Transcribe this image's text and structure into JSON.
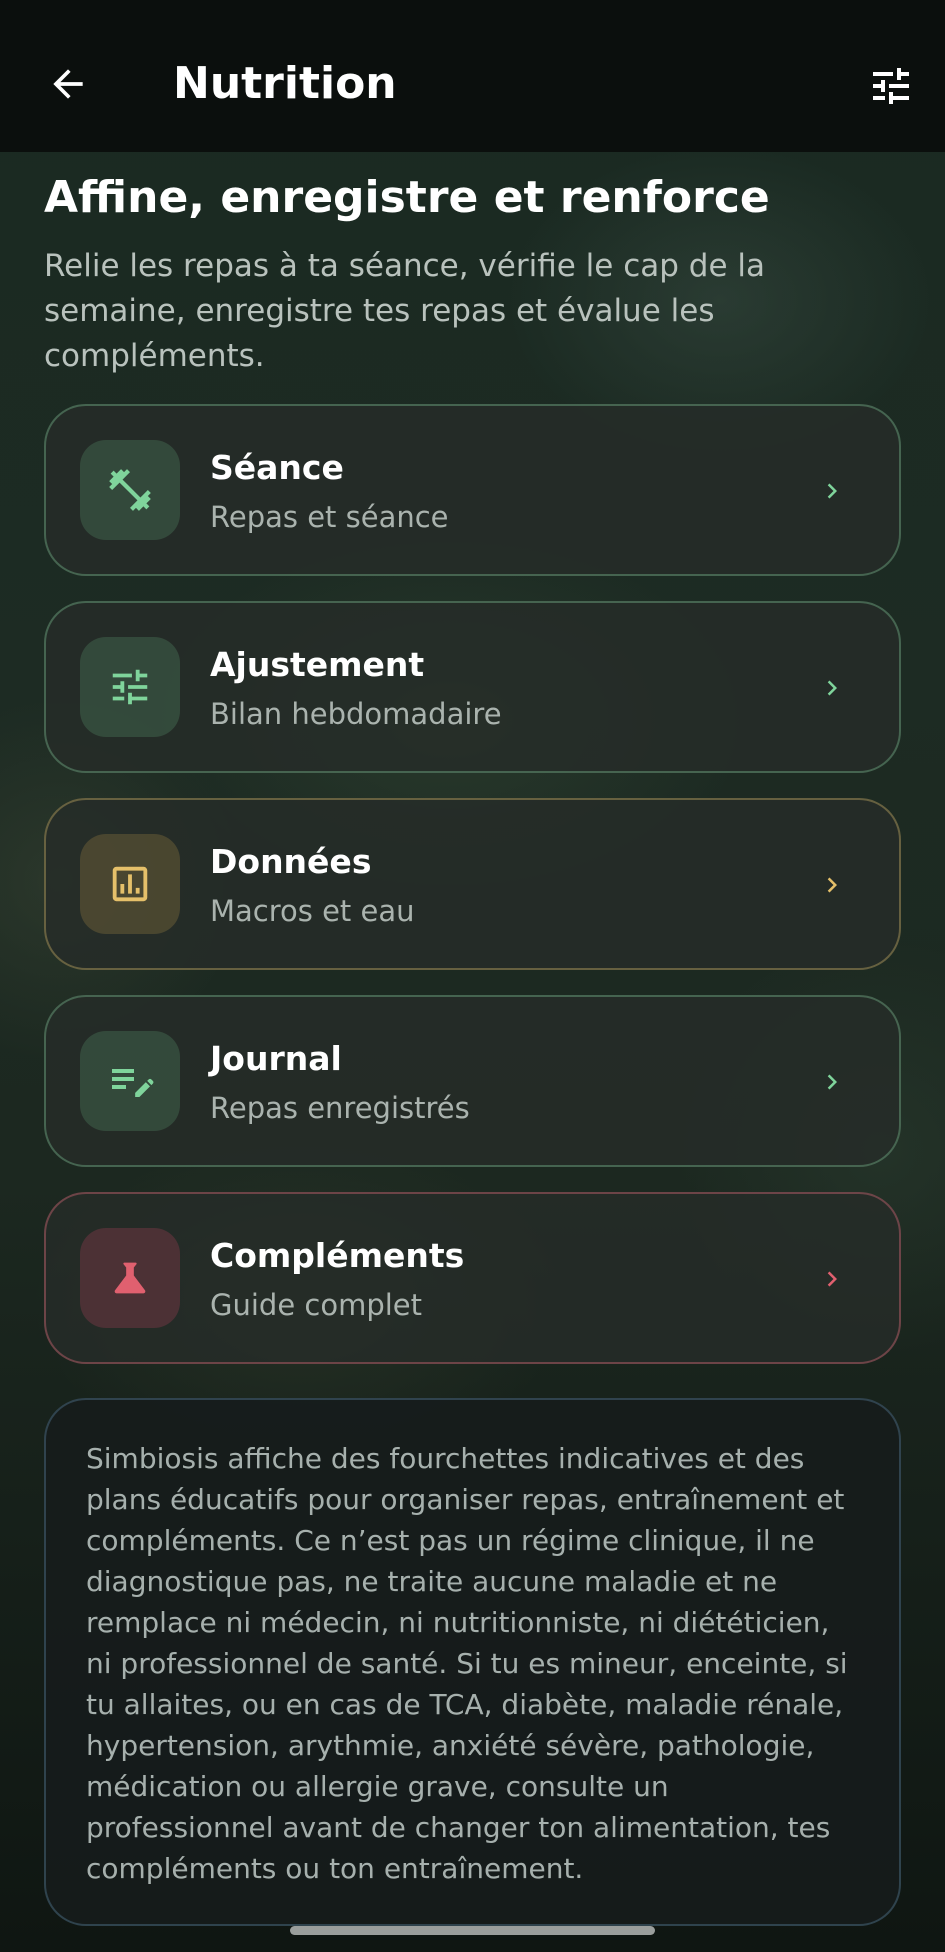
{
  "header": {
    "title": "Nutrition",
    "back_icon": "arrow-left-icon",
    "filter_icon": "tune-icon"
  },
  "main": {
    "heading": "Affine, enregistre et renforce",
    "intro": "Relie les repas à ta séance, vérifie le cap de la semaine, enregistre tes repas et évalue les compléments.",
    "cards": [
      {
        "title": "Séance",
        "subtitle": "Repas et séance",
        "icon": "dumbbell-icon",
        "accent": "#7fd49b"
      },
      {
        "title": "Ajustement",
        "subtitle": "Bilan hebdomadaire",
        "icon": "tune-icon",
        "accent": "#7fd49b"
      },
      {
        "title": "Données",
        "subtitle": "Macros et eau",
        "icon": "bar-chart-icon",
        "accent": "#e5c06a"
      },
      {
        "title": "Journal",
        "subtitle": "Repas enregistrés",
        "icon": "edit-list-icon",
        "accent": "#7fd49b"
      },
      {
        "title": "Compléments",
        "subtitle": "Guide complet",
        "icon": "flask-icon",
        "accent": "#e0606f"
      }
    ],
    "disclaimer": "Simbiosis affiche des fourchettes indicatives et des plans éducatifs pour organiser repas, entraînement et compléments. Ce n’est pas un régime clinique, il ne diagnostique pas, ne traite aucune maladie et ne remplace ni médecin, ni nutritionniste, ni diététicien, ni professionnel de santé. Si tu es mineur, enceinte, si tu allaites, ou en cas de TCA, diabète, maladie rénale, hypertension, arythmie, anxiété sévère, pathologie, médication ou allergie grave, consulte un professionnel avant de changer ton alimentation, tes compléments ou ton entraînement."
  }
}
